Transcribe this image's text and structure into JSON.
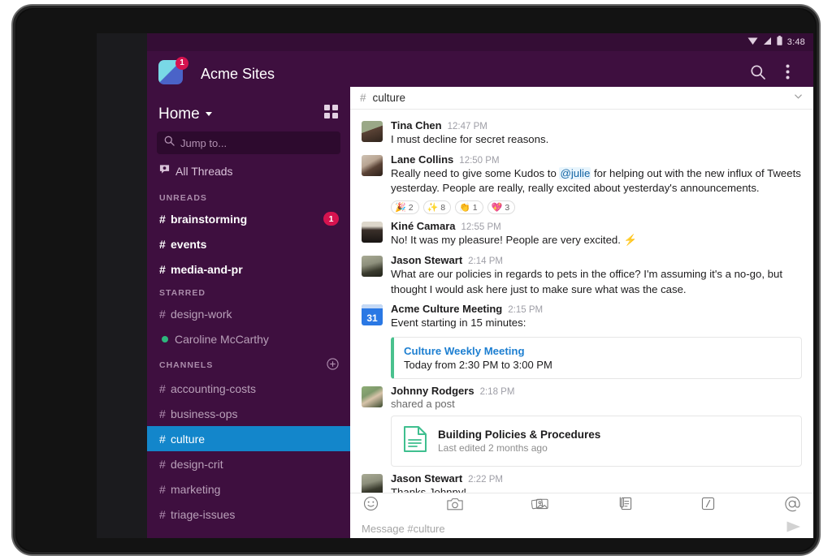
{
  "status_bar": {
    "clock": "3:48",
    "icons": [
      "wifi-icon",
      "cellular-signal-icon",
      "battery-icon"
    ]
  },
  "app_header": {
    "workspace_title": "Acme Sites",
    "badge_count": "1",
    "search_icon": "search-icon",
    "overflow_icon": "overflow-menu-icon"
  },
  "sidebar": {
    "home_label": "Home",
    "grid_icon": "grid-view-icon",
    "jump_placeholder": "Jump to...",
    "all_threads_label": "All Threads",
    "sections": [
      {
        "title": "UNREADS",
        "items": [
          {
            "prefix": "#",
            "label": "brainstorming",
            "unread": true,
            "badge": "1"
          },
          {
            "prefix": "#",
            "label": "events",
            "unread": true,
            "badge": ""
          },
          {
            "prefix": "#",
            "label": "media-and-pr",
            "unread": true,
            "badge": ""
          }
        ]
      },
      {
        "title": "STARRED",
        "items": [
          {
            "prefix": "#",
            "label": "design-work",
            "unread": false,
            "badge": ""
          },
          {
            "prefix": "dot",
            "label": "Caroline McCarthy",
            "unread": false,
            "badge": ""
          }
        ]
      },
      {
        "title": "CHANNELS",
        "add_icon": "add-channel-icon",
        "items": [
          {
            "prefix": "#",
            "label": "accounting-costs",
            "unread": false,
            "badge": ""
          },
          {
            "prefix": "#",
            "label": "business-ops",
            "unread": false,
            "badge": ""
          },
          {
            "prefix": "#",
            "label": "culture",
            "unread": false,
            "badge": "",
            "active": true
          },
          {
            "prefix": "#",
            "label": "design-crit",
            "unread": false,
            "badge": ""
          },
          {
            "prefix": "#",
            "label": "marketing",
            "unread": false,
            "badge": ""
          },
          {
            "prefix": "#",
            "label": "triage-issues",
            "unread": false,
            "badge": ""
          }
        ]
      }
    ]
  },
  "channel_header": {
    "hash": "#",
    "name": "culture",
    "chevron_icon": "chevron-down-icon"
  },
  "messages": [
    {
      "author": "Tina Chen",
      "time": "12:47 PM",
      "text": "I must decline for secret reasons.",
      "avatar_colors": [
        "#9aa887",
        "#5b4336"
      ]
    },
    {
      "author": "Lane Collins",
      "time": "12:50 PM",
      "text_before": "Really need to give some Kudos to ",
      "mention": "@julie",
      "text_after": " for helping out with the new influx of Tweets yesterday. People are really, really excited about yesterday's announcements.",
      "avatar_colors": [
        "#b9a593",
        "#463228"
      ],
      "reactions": [
        {
          "emoji": "🎉",
          "count": "2"
        },
        {
          "emoji": "✨",
          "count": "8"
        },
        {
          "emoji": "👏",
          "count": "1"
        },
        {
          "emoji": "💖",
          "count": "3"
        }
      ]
    },
    {
      "author": "Kiné Camara",
      "time": "12:55 PM",
      "text": "No! It was my pleasure! People are very excited. ⚡",
      "avatar_colors": [
        "#d8d2c6",
        "#2d2722"
      ]
    },
    {
      "author": "Jason Stewart",
      "time": "2:14 PM",
      "text": "What are our policies in regards to pets in the office? I'm assuming it's a no-go, but thought I would ask here just to make sure what was the case.",
      "avatar_colors": [
        "#8d8f7c",
        "#3a3b2e"
      ]
    },
    {
      "author": "Acme Culture Meeting",
      "time": "2:15 PM",
      "text": "Event starting in 15 minutes:",
      "is_calendar": true,
      "calendar_day": "31",
      "event": {
        "title": "Culture Weekly Meeting",
        "subtitle": "Today from 2:30 PM to 3:00 PM"
      }
    },
    {
      "author": "Johnny Rodgers",
      "time": "2:18 PM",
      "subtext": "shared a post",
      "avatar_colors": [
        "#7f9a6c",
        "#3b4a2e"
      ],
      "file": {
        "name": "Building Policies & Procedures",
        "meta": "Last edited 2 months ago",
        "icon": "document-icon"
      }
    },
    {
      "author": "Jason Stewart",
      "time": "2:22 PM",
      "text": "Thanks Johnny!",
      "avatar_colors": [
        "#8d8f7c",
        "#3a3b2e"
      ]
    }
  ],
  "composer": {
    "placeholder": "Message #culture",
    "tools": [
      "emoji-icon",
      "camera-icon",
      "photos-icon",
      "attachment-icon",
      "slash-command-icon",
      "mention-icon"
    ],
    "send_icon": "send-icon"
  },
  "colors": {
    "sidebar_bg": "#3e0f3f",
    "active_channel": "#1386cb",
    "badge_red": "#d6134f",
    "presence_green": "#2eb67d",
    "link_blue": "#1264a3",
    "event_accent": "#4ac18e"
  }
}
